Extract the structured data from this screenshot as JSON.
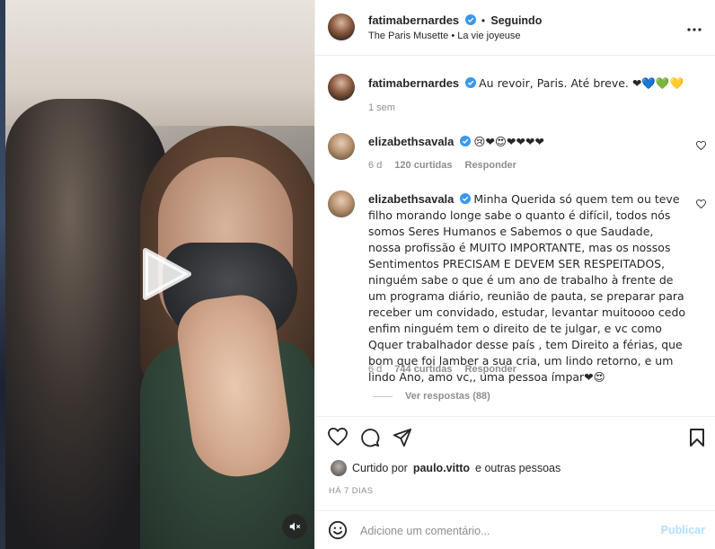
{
  "header": {
    "username": "fatimabernardes",
    "separator": "•",
    "follow_status": "Seguindo",
    "location": "The Paris Musette • La vie joyeuse"
  },
  "caption": {
    "username": "fatimabernardes",
    "text": "Au revoir, Paris. Até breve. ❤💙💚💛",
    "time": "1 sem"
  },
  "comments": [
    {
      "username": "elizabethsavala",
      "text": "😢❤😍❤❤❤❤",
      "time": "6 d",
      "likes": "120 curtidas",
      "reply": "Responder"
    },
    {
      "username": "elizabethsavala",
      "text": "Minha Querida só quem tem ou teve filho morando longe sabe o quanto é difícil, todos nós somos Seres Humanos e Sabemos o que Saudade, nossa profissão é MUITO IMPORTANTE, mas os nossos Sentimentos PRECISAM E DEVEM SER RESPEITADOS, ninguém sabe o que é um ano de trabalho à frente de um programa diário, reunião de pauta, se preparar para receber um convidado, estudar, levantar muitoooo cedo enfim ninguém tem o direito de te julgar, e vc como Qquer trabalhador desse país , tem Direito a férias, que bom que foi lamber a sua cria, um lindo retorno, e um lindo Ano, amo vc,, uma pessoa ímpar❤😍",
      "time": "6 d",
      "likes": "744 curtidas",
      "reply": "Responder",
      "view_replies": "Ver respostas (88)"
    }
  ],
  "likes": {
    "prefix": "Curtido por",
    "user": "paulo.vitto",
    "suffix": "e outras pessoas"
  },
  "posted_ago": "HÁ 7 DIAS",
  "add_comment": {
    "placeholder": "Adicione um comentário...",
    "publish_label": "Publicar"
  },
  "colors": {
    "verified": "#3897f0",
    "publish_disabled": "#b2dffc",
    "text": "#262626",
    "muted": "#8e8e8e"
  },
  "icons": [
    "play-icon",
    "mute-icon",
    "more-options-icon",
    "heart-icon",
    "comment-icon",
    "share-icon",
    "bookmark-icon",
    "emoji-icon",
    "verified-icon"
  ]
}
